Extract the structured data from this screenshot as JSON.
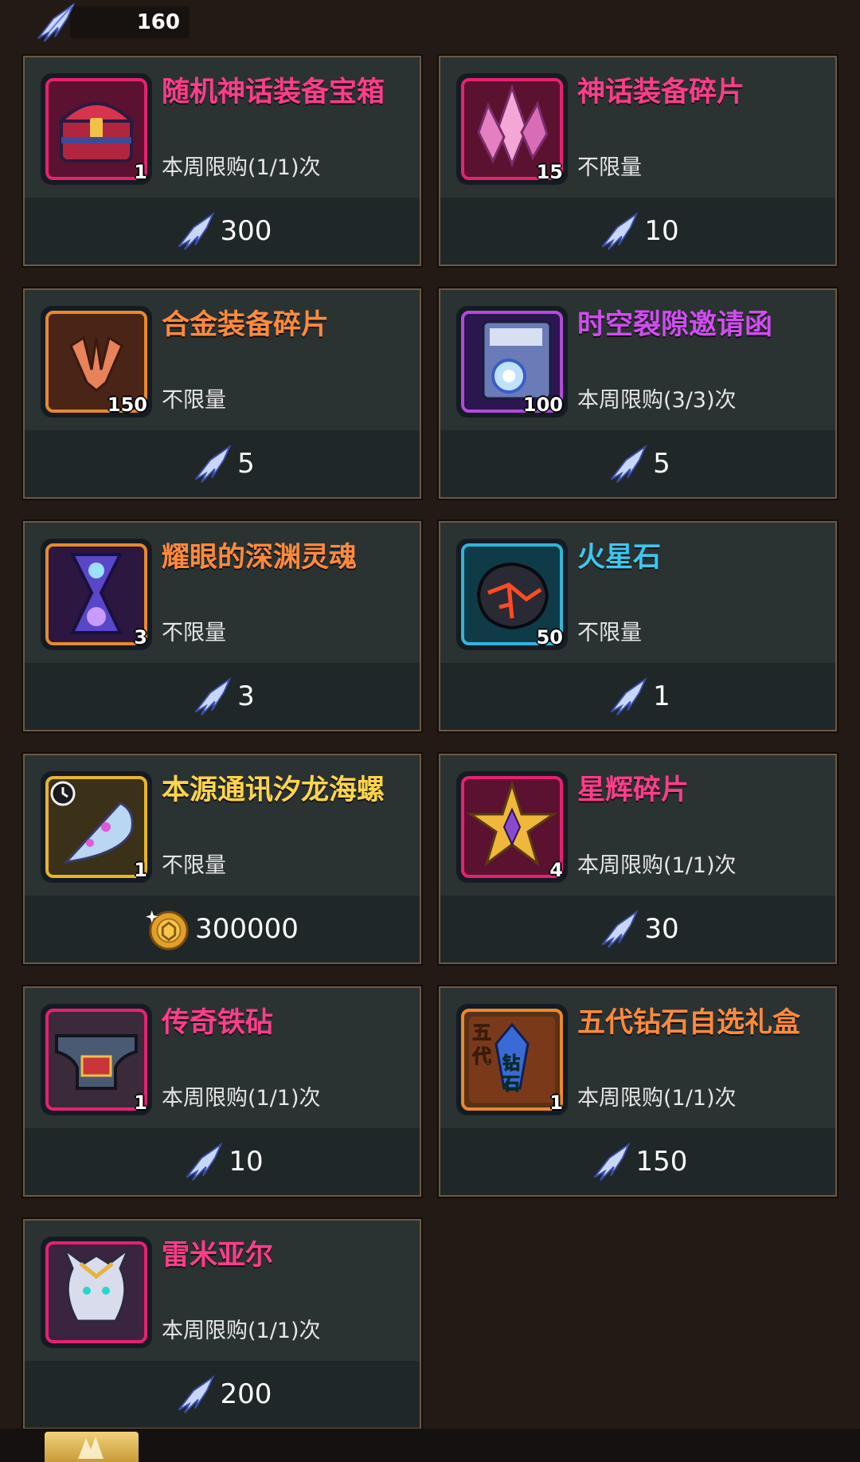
{
  "currency": {
    "icon": "crystal-feather-icon",
    "amount": "160"
  },
  "colors": {
    "pink": "#ff3d8b",
    "orange": "#ff8a3d",
    "purple": "#d04df0",
    "cyan": "#39c9f0",
    "gold": "#ffd54a"
  },
  "items": [
    {
      "name": "随机神话装备宝箱",
      "qty": "1",
      "limit": "本周限购(1/1)次",
      "price": "300",
      "icon": "treasure-chest-icon"
    },
    {
      "name": "神话装备碎片",
      "qty": "15",
      "limit": "不限量",
      "price": "10",
      "icon": "pink-crystal-icon"
    },
    {
      "name": "合金装备碎片",
      "qty": "150",
      "limit": "不限量",
      "price": "5",
      "icon": "alloy-shard-icon"
    },
    {
      "name": "时空裂隙邀请函",
      "qty": "100",
      "limit": "本周限购(3/3)次",
      "price": "5",
      "icon": "invitation-scroll-icon"
    },
    {
      "name": "耀眼的深渊灵魂",
      "qty": "3",
      "limit": "不限量",
      "price": "3",
      "icon": "abyss-soul-icon"
    },
    {
      "name": "火星石",
      "qty": "50",
      "limit": "不限量",
      "price": "1",
      "icon": "magma-stone-icon"
    },
    {
      "name": "本源通讯汐龙海螺",
      "qty": "1",
      "limit": "不限量",
      "price": "300000",
      "icon": "dragon-conch-icon"
    },
    {
      "name": "星辉碎片",
      "qty": "4",
      "limit": "本周限购(1/1)次",
      "price": "30",
      "icon": "star-shard-icon"
    },
    {
      "name": "传奇铁砧",
      "qty": "1",
      "limit": "本周限购(1/1)次",
      "price": "10",
      "icon": "anvil-icon"
    },
    {
      "name": "五代钻石自选礼盒",
      "qty": "1",
      "limit": "本周限购(1/1)次",
      "price": "150",
      "icon": "diamond-gift-box-icon",
      "badge_text": [
        "五",
        "代",
        "钻",
        "石"
      ]
    },
    {
      "name": "雷米亚尔",
      "qty": "",
      "limit": "本周限购(1/1)次",
      "price": "200",
      "icon": "dragon-hero-portrait-icon"
    }
  ]
}
